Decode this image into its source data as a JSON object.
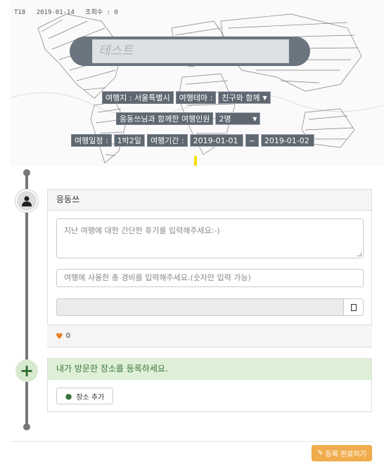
{
  "meta": {
    "id": "T18",
    "date": "2019-01-14",
    "views_label": "조회수 : 0"
  },
  "hero": {
    "title_value": "테스트",
    "destination_label": "여행지 : 서울특별시",
    "theme_label": "여행테마 :",
    "theme_value": "친구와 함께",
    "companion_label": "응동쓰님과 함께한 여행인원",
    "companion_value": "2명",
    "schedule_label": "여행일정 :",
    "schedule_value": "1박2일",
    "period_label": "여행기간 :",
    "start_date": "2019-01-01",
    "tilde": "~",
    "end_date": "2019-01-02"
  },
  "review_card": {
    "author": "응동쓰",
    "review_placeholder": "지난 여행에 대한 간단한 후기를 입력해주세요:-)",
    "cost_placeholder": "여행에 사용한 총 경비를 입력해주세요.(숫자만 입력 가능)",
    "likes": "0"
  },
  "place_card": {
    "heading": "내가 방문한 장소를 등록하세요.",
    "add_button": "장소  추가"
  },
  "footer": {
    "submit_label": "등록 완료하기"
  },
  "colors": {
    "accent": "#f0ad4e",
    "success_bg": "#dff0d8",
    "success_text": "#3c763d",
    "timeline": "#777777"
  },
  "icons": {
    "avatar": "user-icon",
    "plus": "plus-icon",
    "heart": "heart-icon",
    "pin": "map-marker-icon",
    "pencil": "pencil-icon",
    "file": "file-icon"
  }
}
